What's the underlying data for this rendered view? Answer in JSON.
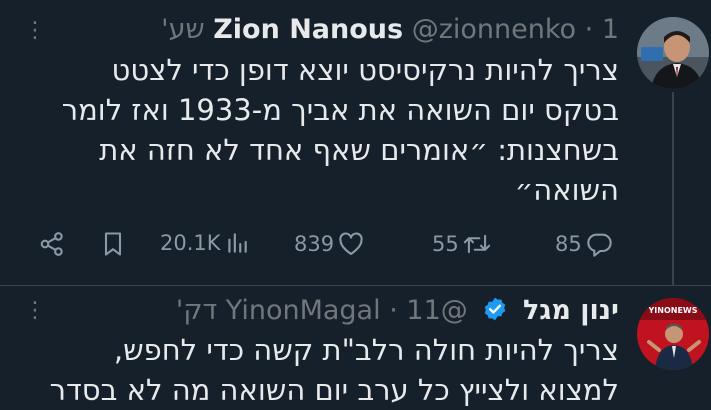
{
  "tweets": [
    {
      "author_name": "Zion Nanous",
      "handle": "@zionnenko",
      "separator": "·",
      "time": "1 שע'",
      "text_lines": [
        "צריך להיות נרקיסיסט יוצא דופן כדי לצטט",
        "בטקס יום השואה את אביך מ-1933 ואז לומר",
        "בשחצנות: ״אומרים שאף אחד לא חזה את",
        "השואה״"
      ],
      "stats": {
        "replies": "85",
        "retweets": "55",
        "likes": "839",
        "views": "20.1K"
      },
      "icons": [
        "reply-icon",
        "retweet-icon",
        "like-icon",
        "views-icon",
        "bookmark-icon",
        "share-icon"
      ]
    },
    {
      "author_name": "ינון מגל",
      "handle": "@YinonMagal",
      "separator": "·",
      "time": "11 דק'",
      "verified": true,
      "avatar_caption": "YINONEWS",
      "text_lines": [
        "צריך להיות חולה רלב\"ת קשה כדי לחפש,",
        "למצוא ולצייץ כל ערב יום השואה מה לא בסדר"
      ]
    }
  ],
  "colors": {
    "background": "#15202b",
    "text": "#e7e9ea",
    "muted": "#71767b",
    "verified": "#1d9bf0",
    "divider": "#38444d"
  }
}
